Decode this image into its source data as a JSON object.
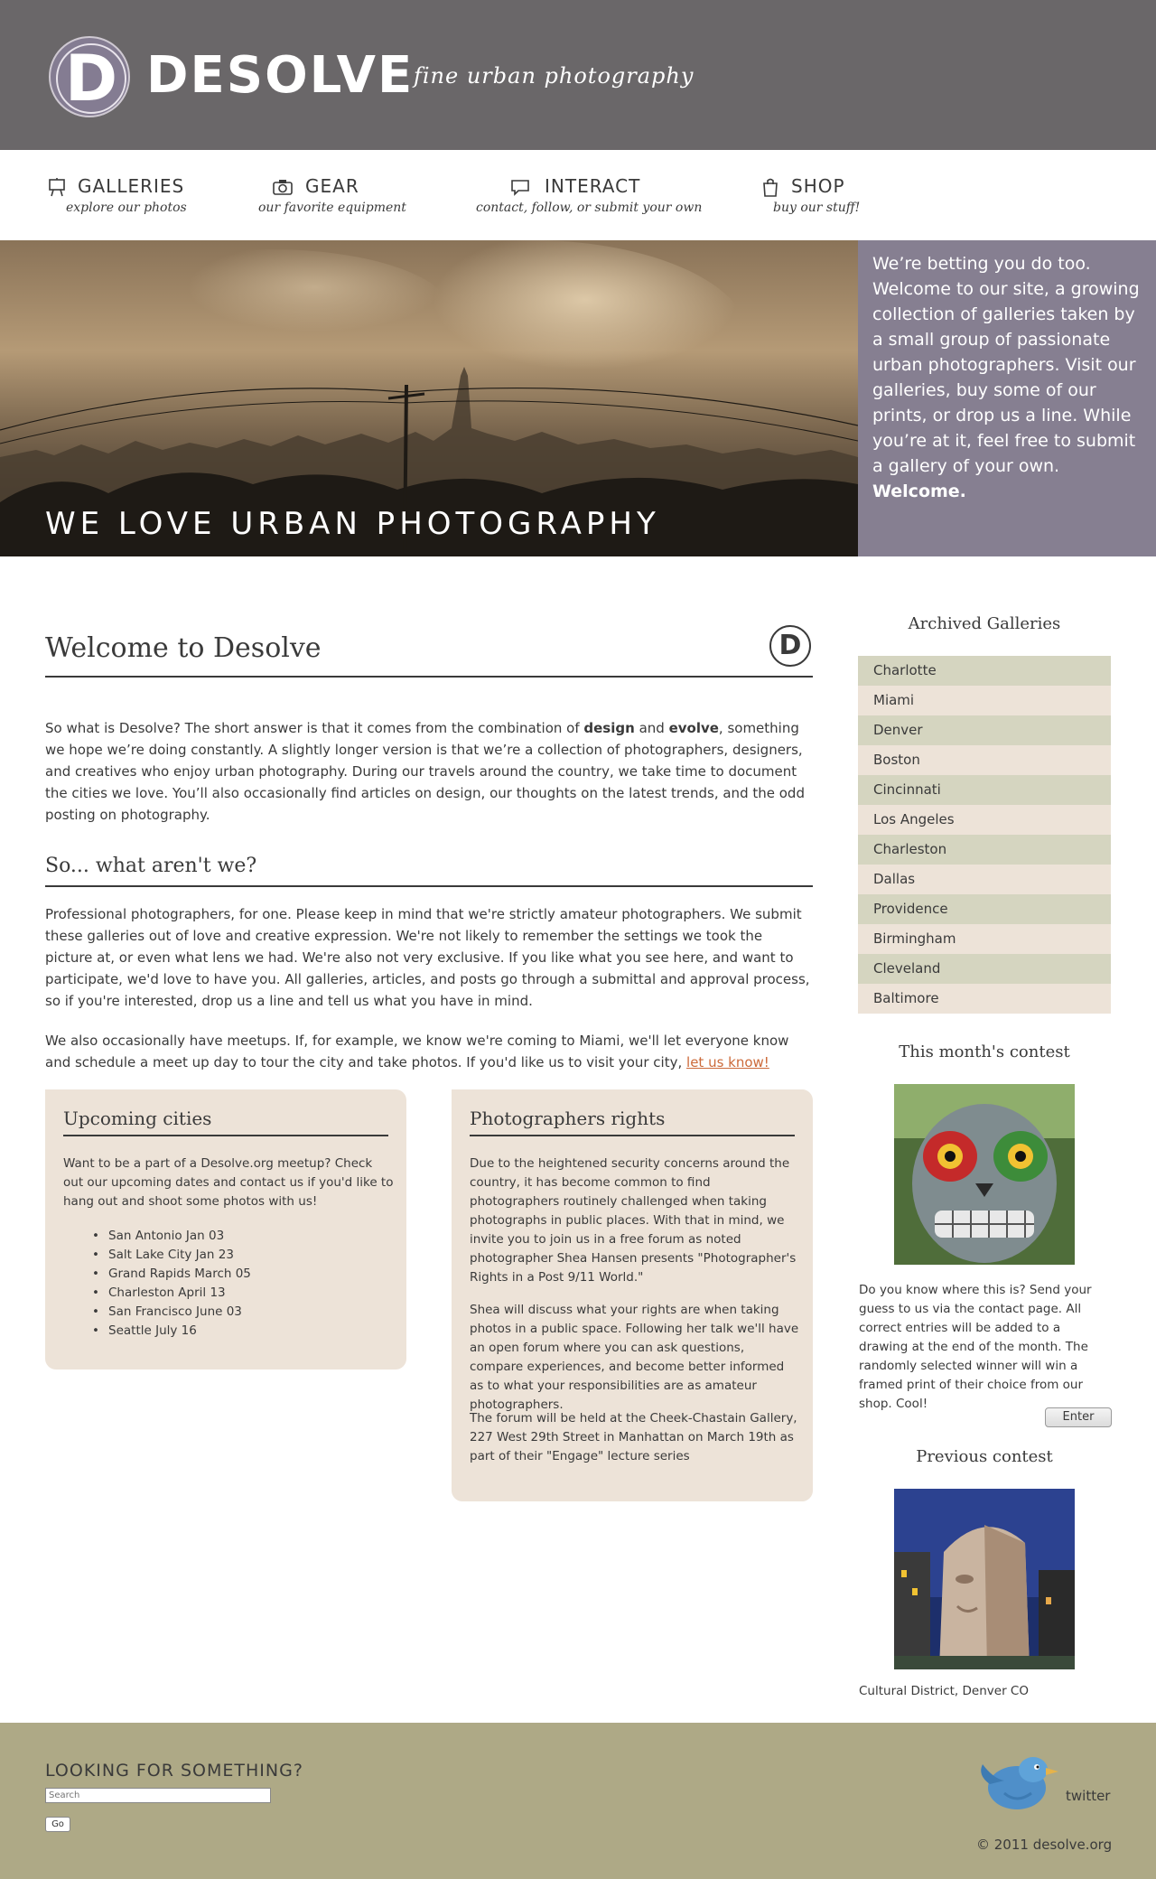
{
  "header": {
    "logo_letter": "D",
    "brand": "DESOLVE",
    "tagline": "fine urban photography"
  },
  "nav": [
    {
      "title": "GALLERIES",
      "subtitle": "explore our photos",
      "icon": "easel-icon"
    },
    {
      "title": "GEAR",
      "subtitle": "our favorite equipment",
      "icon": "camera-icon"
    },
    {
      "title": "INTERACT",
      "subtitle": "contact, follow, or submit your own",
      "icon": "speech-bubble-icon"
    },
    {
      "title": "SHOP",
      "subtitle": "buy our stuff!",
      "icon": "shopping-bag-icon"
    }
  ],
  "hero": {
    "title": "WE LOVE URBAN PHOTOGRAPHY",
    "side_text": "We’re betting you do too. Welcome to our site, a growing collection of galleries taken by a small group of passionate urban photographers. Visit our galleries, buy some of our prints, or drop us a line. While you’re at it, feel free to submit a gallery of your own.",
    "side_strong": "Welcome."
  },
  "main": {
    "title": "Welcome to Desolve",
    "badge_letter": "D",
    "intro": {
      "a": "So what is Desolve? The short answer is that it comes from the combination of ",
      "b1": "design",
      "c": " and ",
      "b2": "evolve",
      "d": ", something we hope we’re doing constantly. A slightly longer version is that we’re a collection of photographers, designers, and creatives who enjoy urban photography. During our travels around the country, we take time to document the cities we love. You’ll also occasionally find articles on design, our thoughts on the latest trends, and the odd posting on photography."
    },
    "subtitle": "So... what aren't we?",
    "para2": "Professional photographers, for one. Please keep in mind that we're strictly amateur photographers. We submit these galleries out of love and creative expression. We're not likely to remember the settings we took the picture at, or even what lens we had. We're also not very exclusive. If you like what you see here, and want to participate, we'd love to have you. All galleries, articles, and posts go through a submittal and approval process, so if you're interested, drop us a line and tell us what you have in mind.",
    "para3": "We also occasionally have meetups. If, for example, we know we're coming to Miami, we'll let everyone know and schedule a meet up day to tour the city and take photos. If you'd like us to visit your city,",
    "para3_link": "let us know!",
    "upcoming": {
      "title": "Upcoming cities",
      "text": "Want to be a part of a Desolve.org meetup? Check out our upcoming dates and contact us if you'd like to hang out and shoot some photos with us!",
      "cities": [
        "San Antonio Jan 03",
        "Salt Lake City Jan 23",
        "Grand Rapids March 05",
        "Charleston April 13",
        "San Francisco June 03",
        "Seattle July 16"
      ]
    },
    "rights": {
      "title": "Photographers rights",
      "p1": "Due to the heightened security concerns around the country, it has become common to find photographers routinely challenged when taking photographs in public places. With that in mind, we invite you to join us in a free forum as noted photographer Shea Hansen presents \"Photographer's Rights in a Post 9/11 World.\"",
      "p2": "Shea will discuss what your rights are when taking photos in a public space. Following her talk we'll have an open forum where you can ask questions, compare experiences, and become better informed as to what your responsibilities are as amateur photographers.",
      "p3": "The forum will be held at the Cheek-Chastain Gallery, 227 West 29th Street in Manhattan on March 19th as part of their \"Engage\" lecture series"
    }
  },
  "sidebar": {
    "archive_title": "Archived Galleries",
    "archive": [
      "Charlotte",
      "Miami",
      "Denver",
      "Boston",
      "Cincinnati",
      "Los Angeles",
      "Charleston",
      "Dallas",
      "Providence",
      "Birmingham",
      "Cleveland",
      "Baltimore"
    ],
    "contest_title": "This month's contest",
    "contest_text": "Do you know where this is? Send your guess to us via the contact page. All correct entries will be added to a drawing at the end of the month. The randomly selected winner will win a framed print of their choice from our shop. Cool!",
    "enter_label": "Enter",
    "prev_title": "Previous contest",
    "prev_caption": "Cultural District, Denver CO"
  },
  "footer": {
    "heading": "LOOKING FOR SOMETHING?",
    "search_placeholder": "Search",
    "go_label": "Go",
    "twitter_label": "twitter",
    "copyright": "© 2011 desolve.org"
  },
  "colors": {
    "header_bg": "#6a6769",
    "hero_side_bg": "#867f91",
    "archive_odd": "#d5d5c0",
    "archive_even": "#ede3d8",
    "box_bg": "#ede3d8",
    "footer_bg": "#aea986",
    "link": "#cc6a3a"
  }
}
